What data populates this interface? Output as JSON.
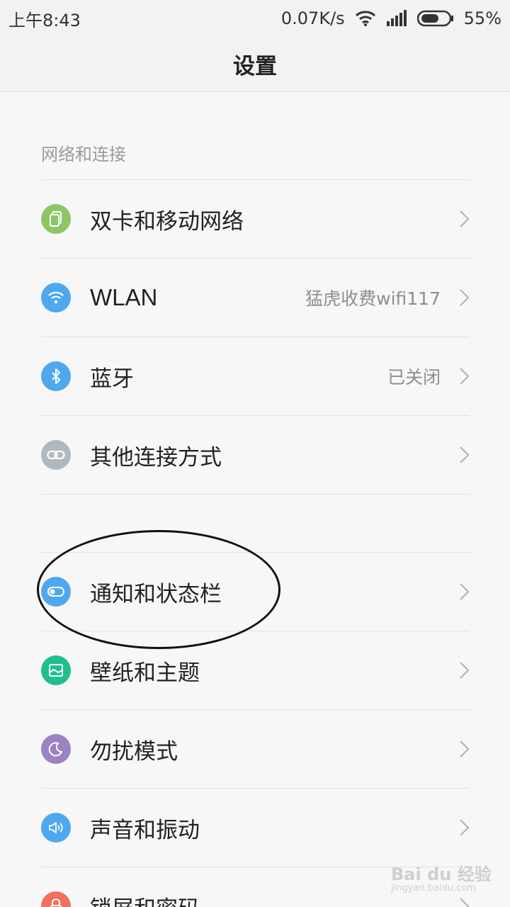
{
  "status_bar": {
    "time": "上午8:43",
    "speed": "0.07K/s",
    "battery": "55%"
  },
  "header": {
    "title": "设置"
  },
  "sections": [
    {
      "header": "网络和连接",
      "items": [
        {
          "label": "双卡和移动网络",
          "value": "",
          "icon": "sim-card-icon",
          "color": "#8cc665"
        },
        {
          "label": "WLAN",
          "value": "猛虎收费wifi117",
          "icon": "wifi-icon",
          "color": "#4ea8ee"
        },
        {
          "label": "蓝牙",
          "value": "已关闭",
          "icon": "bluetooth-icon",
          "color": "#4ea8ee"
        },
        {
          "label": "其他连接方式",
          "value": "",
          "icon": "link-icon",
          "color": "#b1b8bf"
        }
      ]
    },
    {
      "header": "",
      "items": [
        {
          "label": "通知和状态栏",
          "value": "",
          "icon": "toggle-icon",
          "color": "#4ea8ee"
        },
        {
          "label": "壁纸和主题",
          "value": "",
          "icon": "wallpaper-icon",
          "color": "#1fbf8f"
        },
        {
          "label": "勿扰模式",
          "value": "",
          "icon": "moon-icon",
          "color": "#9b82c2"
        },
        {
          "label": "声音和振动",
          "value": "",
          "icon": "speaker-icon",
          "color": "#4ea8ee"
        },
        {
          "label": "锁屏和密码",
          "value": "",
          "icon": "lock-icon",
          "color": "#f2715d"
        }
      ]
    }
  ],
  "watermark": {
    "brand": "Bai du 经验",
    "url": "jingyan.baidu.com"
  }
}
